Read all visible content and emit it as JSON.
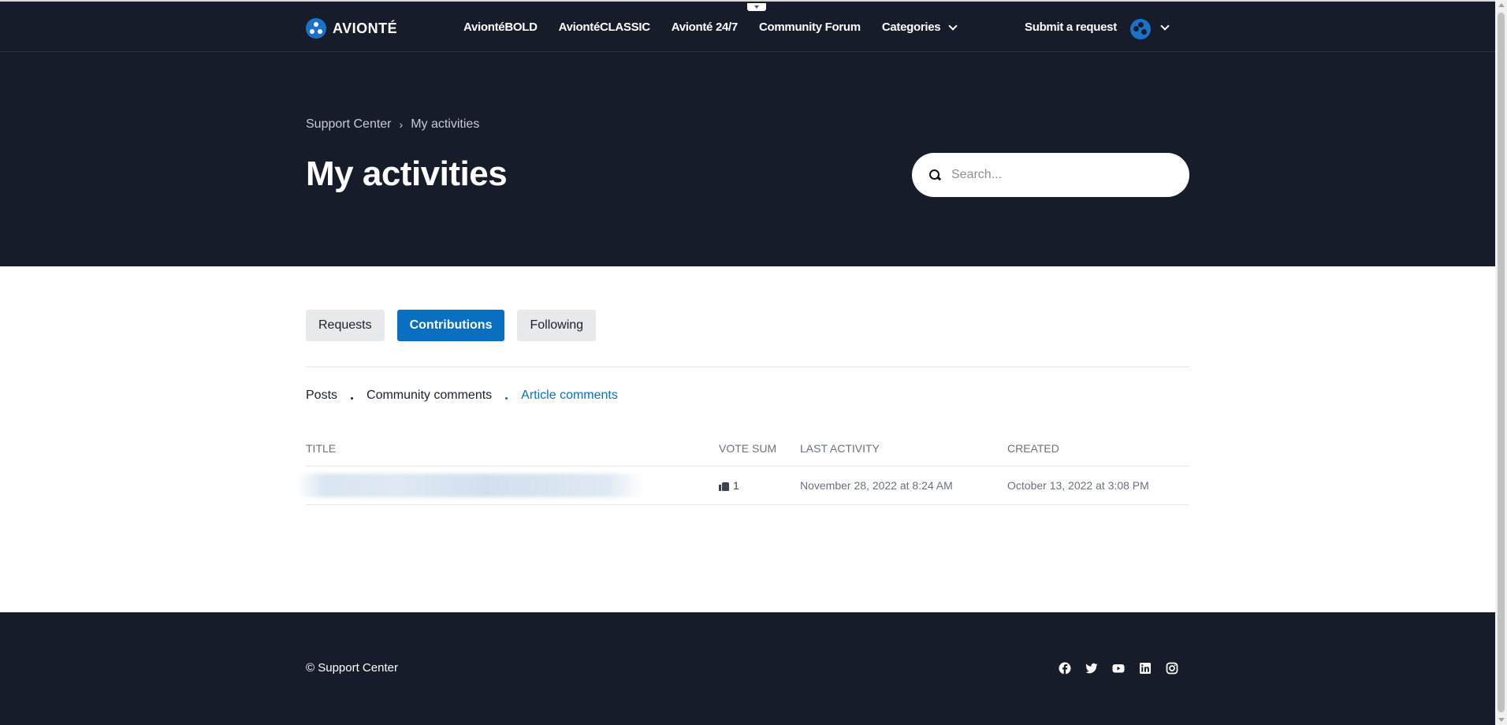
{
  "header": {
    "brand": "AVIONTÉ",
    "nav": [
      {
        "label": "AviontéBOLD"
      },
      {
        "label": "AviontéCLASSIC"
      },
      {
        "label": "Avionté 24/7"
      },
      {
        "label": "Community Forum"
      },
      {
        "label": "Categories"
      }
    ],
    "submit_request": "Submit a request"
  },
  "hero": {
    "breadcrumb": [
      "Support Center",
      "My activities"
    ],
    "breadcrumb_sep": "›",
    "title": "My activities",
    "search_placeholder": "Search..."
  },
  "tabs": [
    {
      "label": "Requests",
      "active": false
    },
    {
      "label": "Contributions",
      "active": true
    },
    {
      "label": "Following",
      "active": false
    }
  ],
  "subtabs": [
    {
      "label": "Posts",
      "active": false
    },
    {
      "label": "Community comments",
      "active": false
    },
    {
      "label": "Article comments",
      "active": true
    }
  ],
  "table": {
    "columns": [
      "Title",
      "Vote sum",
      "Last activity",
      "Created"
    ],
    "rows": [
      {
        "title": "",
        "vote_sum": "1",
        "last_activity": "November 28, 2022 at 8:24 AM",
        "created": "October 13, 2022 at 3:08 PM"
      }
    ]
  },
  "footer": {
    "copyright": "© Support Center",
    "social": [
      "facebook-icon",
      "twitter-icon",
      "youtube-icon",
      "linkedin-icon",
      "instagram-icon"
    ]
  },
  "colors": {
    "dark_bg": "#171c2b",
    "accent": "#0b6fc1"
  }
}
